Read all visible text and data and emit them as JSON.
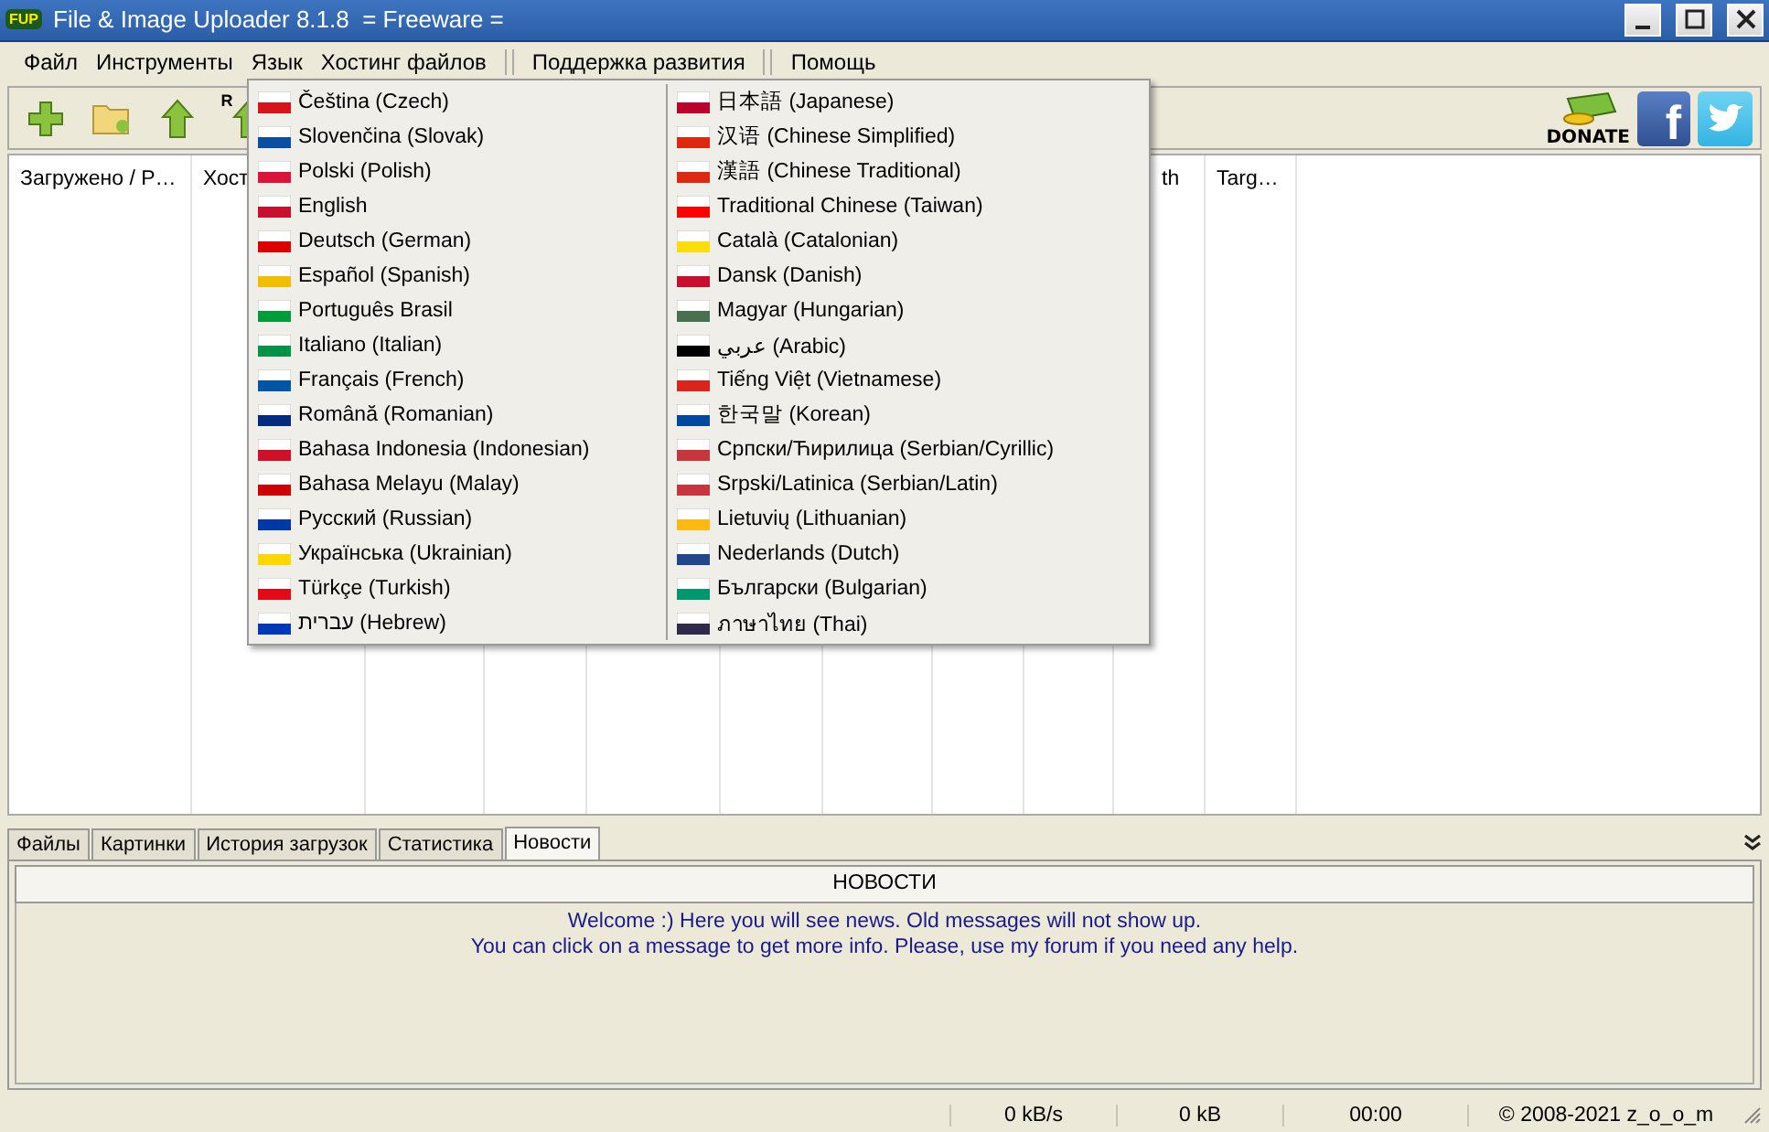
{
  "window": {
    "title": "File & Image Uploader 8.1.8  = Freeware =",
    "logo": "FUP"
  },
  "menu": [
    {
      "kind": "item",
      "label": "Файл"
    },
    {
      "kind": "item",
      "label": "Инструменты"
    },
    {
      "kind": "item",
      "label": "Язык"
    },
    {
      "kind": "item",
      "label": "Хостинг файлов"
    },
    {
      "kind": "separator"
    },
    {
      "kind": "item",
      "label": "Поддержка развития"
    },
    {
      "kind": "separator"
    },
    {
      "kind": "item",
      "label": "Помощь"
    }
  ],
  "toolbar": [
    {
      "kind": "add"
    },
    {
      "kind": "folder"
    },
    {
      "kind": "upload"
    },
    {
      "kind": "upload_r",
      "label": "R"
    }
  ],
  "social": [
    {
      "kind": "donate",
      "label": "DONATE"
    },
    {
      "kind": "facebook",
      "label": "f"
    },
    {
      "kind": "twitter"
    }
  ],
  "table": {
    "columns": [
      "Загружено / Р…",
      "Хост",
      "th",
      "Targ…"
    ]
  },
  "language_menu": {
    "columns": [
      [
        {
          "label": "Čeština (Czech)",
          "color": "#d7141a"
        },
        {
          "label": "Slovenčina (Slovak)",
          "color": "#0b4ea2"
        },
        {
          "label": "Polski (Polish)",
          "color": "#dc143c"
        },
        {
          "label": "English",
          "color": "#c8102e"
        },
        {
          "label": "Deutsch (German)",
          "color": "#dd0000"
        },
        {
          "label": "Español (Spanish)",
          "color": "#f1bf00"
        },
        {
          "label": "Português Brasil",
          "color": "#009c3b"
        },
        {
          "label": "Italiano (Italian)",
          "color": "#009246"
        },
        {
          "label": "Français (French)",
          "color": "#0055a4"
        },
        {
          "label": "Română (Romanian)",
          "color": "#002b7f"
        },
        {
          "label": "Bahasa Indonesia (Indonesian)",
          "color": "#ce1126"
        },
        {
          "label": "Bahasa Melayu (Malay)",
          "color": "#cc0001"
        },
        {
          "label": "Русский (Russian)",
          "color": "#0039a6"
        },
        {
          "label": "Українська (Ukrainian)",
          "color": "#ffd700"
        },
        {
          "label": "Türkçe (Turkish)",
          "color": "#e30a17"
        },
        {
          "label": "עברית (Hebrew)",
          "color": "#0038b8"
        }
      ],
      [
        {
          "label": "日本語 (Japanese)",
          "color": "#bc002d"
        },
        {
          "label": "汉语 (Chinese Simplified)",
          "color": "#de2910"
        },
        {
          "label": "漢語 (Chinese Traditional)",
          "color": "#de2910"
        },
        {
          "label": "Traditional Chinese (Taiwan)",
          "color": "#fe0000"
        },
        {
          "label": "Català (Catalonian)",
          "color": "#fcdd09"
        },
        {
          "label": "Dansk (Danish)",
          "color": "#c8102e"
        },
        {
          "label": "Magyar (Hungarian)",
          "color": "#477050"
        },
        {
          "label": "عربي (Arabic)",
          "color": "#000000"
        },
        {
          "label": "Tiếng Việt (Vietnamese)",
          "color": "#da251d"
        },
        {
          "label": "한국말 (Korean)",
          "color": "#0047a0"
        },
        {
          "label": "Српски/Ћирилица (Serbian/Cyrillic)",
          "color": "#c6363c"
        },
        {
          "label": "Srpski/Latinica (Serbian/Latin)",
          "color": "#c6363c"
        },
        {
          "label": "Lietuvių (Lithuanian)",
          "color": "#fdb913"
        },
        {
          "label": "Nederlands (Dutch)",
          "color": "#21468b"
        },
        {
          "label": "Български (Bulgarian)",
          "color": "#00966e"
        },
        {
          "label": "ภาษาไทย (Thai)",
          "color": "#2d2a4a"
        }
      ]
    ]
  },
  "tabs": [
    {
      "label": "Файлы",
      "selected": false
    },
    {
      "label": "Картинки",
      "selected": false
    },
    {
      "label": "История загрузок",
      "selected": false
    },
    {
      "label": "Статистика",
      "selected": false
    },
    {
      "label": "Новости",
      "selected": true
    }
  ],
  "news": {
    "header": "НОВОСТИ",
    "lines": [
      "Welcome :) Here you will see news. Old messages will not show up.",
      "You can click on a message to get more info. Please, use my forum if you need any help."
    ]
  },
  "status_bar": [
    "0 kB/s",
    "0 kB",
    "00:00",
    "© 2008-2021 z_o_o_m"
  ]
}
